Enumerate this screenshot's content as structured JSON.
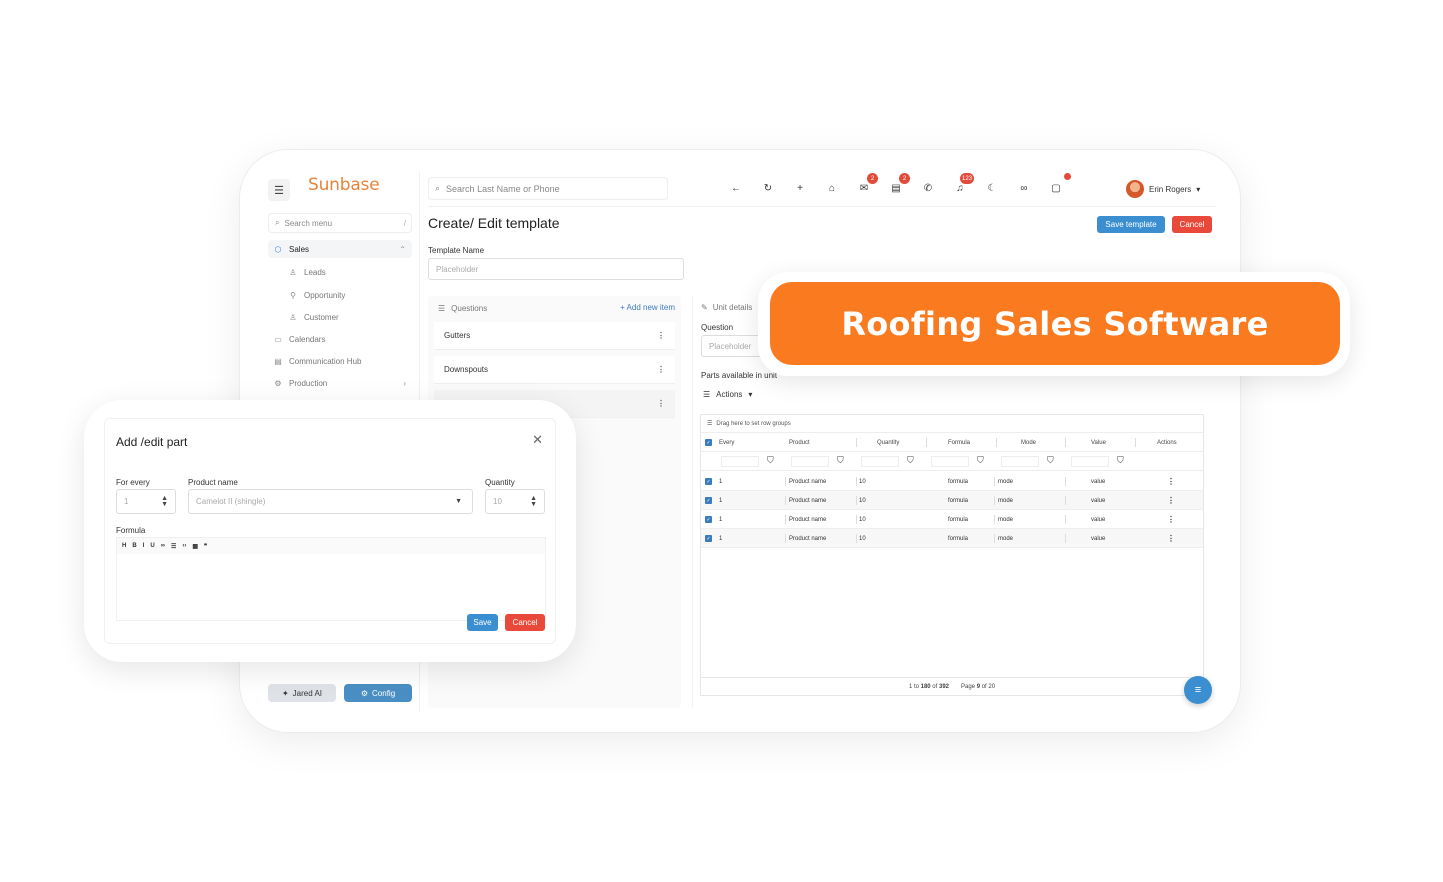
{
  "sidebar": {
    "logo": "Sunbase",
    "search_placeholder": "Search menu",
    "search_shortcut": "/",
    "items": [
      {
        "label": "Sales"
      },
      {
        "label": "Leads"
      },
      {
        "label": "Opportunity"
      },
      {
        "label": "Customer"
      },
      {
        "label": "Calendars"
      },
      {
        "label": "Communication Hub"
      },
      {
        "label": "Production"
      }
    ],
    "jared_label": "Jared AI",
    "config_label": "Config"
  },
  "topbar": {
    "search_placeholder": "Search Last Name or Phone",
    "mail_badge": "2",
    "chat_badge": "2",
    "notif_badge": "123",
    "user_name": "Erin Rogers"
  },
  "main": {
    "title": "Create/ Edit template",
    "save_label": "Save template",
    "cancel_label": "Cancel",
    "template_name_label": "Template Name",
    "template_name_placeholder": "Placeholder"
  },
  "questions": {
    "header": "Questions",
    "add_label": "Add new item",
    "items": [
      "Gutters",
      "Downspouts",
      ""
    ]
  },
  "unit": {
    "header": "Unit details",
    "question_label": "Question",
    "question_placeholder": "Placeholder",
    "parts_label": "Parts available in unit",
    "actions_label": "Actions"
  },
  "grid": {
    "drag_hint": "Drag here to set row groups",
    "columns": [
      "Every",
      "Product",
      "Quantity",
      "Formula",
      "Mode",
      "Value",
      "Actions"
    ],
    "rows": [
      {
        "every": "1",
        "product": "Product name",
        "quantity": "10",
        "formula": "formula",
        "mode": "mode",
        "value": "value"
      },
      {
        "every": "1",
        "product": "Product name",
        "quantity": "10",
        "formula": "formula",
        "mode": "mode",
        "value": "value"
      },
      {
        "every": "1",
        "product": "Product name",
        "quantity": "10",
        "formula": "formula",
        "mode": "mode",
        "value": "value"
      },
      {
        "every": "1",
        "product": "Product name",
        "quantity": "10",
        "formula": "formula",
        "mode": "mode",
        "value": "value"
      }
    ],
    "range_from": "1",
    "range_to": "180",
    "range_total": "392",
    "page": "9",
    "page_total": "20"
  },
  "banner": {
    "text": "Roofing Sales Software",
    "color": "#f97a1f"
  },
  "modal": {
    "title": "Add /edit part",
    "for_every_label": "For every",
    "for_every_value": "1",
    "product_label": "Product name",
    "product_value": "Camelot II (shingle)",
    "quantity_label": "Quantity",
    "quantity_value": "10",
    "formula_label": "Formula",
    "toolbar": [
      "H",
      "B",
      "I",
      "U",
      "∞",
      "☰",
      "‹›",
      "▦",
      "❞"
    ],
    "save_label": "Save",
    "cancel_label": "Cancel"
  },
  "colors": {
    "accent": "#3b8ed0",
    "danger": "#e8493a",
    "brand": "#e8833a"
  }
}
